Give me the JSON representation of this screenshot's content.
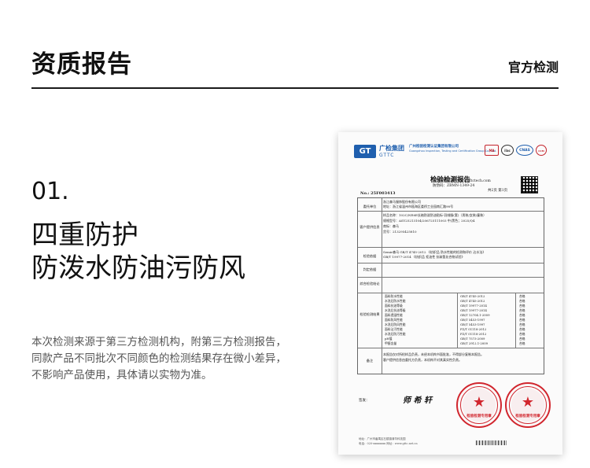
{
  "header": {
    "title": "资质报告",
    "tag": "官方检测"
  },
  "section": {
    "index": "01.",
    "heading_lines": [
      "四重防护",
      "防泼水防油污防风"
    ],
    "description_lines": [
      "本次检测来源于第三方检测机构，附第三方检测报告，",
      "同款产品不同批次不同颜色的检测结果存在微小差异，",
      "不影响产品使用，具体请以实物为准。"
    ]
  },
  "document": {
    "logo_mark": "GT",
    "logo_cn": "广检集团",
    "logo_en": "GTTC",
    "institute_cn": "广州检验检测认证集团有限公司",
    "institute_en": "Guangzhou Inspection, Testing and Certification Group Co., Ltd.",
    "certs": [
      "MA",
      "ilac",
      "CNAS",
      "CCM"
    ],
    "report_title": "检验检测报告",
    "meta_lines": [
      "报告查询网址：www.gttctech.com",
      "防伪码：ZBMN-1349-24",
      "共2页 第1页"
    ],
    "report_no": "No.: 25F003413",
    "table": {
      "labels": {
        "client": "委托单位",
        "sample": "客户提供信息",
        "test_basis": "检验依据",
        "conclusion": "判定依据",
        "overview": "综合检验结论",
        "results": "检验检测结果",
        "remarks": "备注"
      },
      "client_lines": [
        "浙江森马服饰股份有限公司",
        "地址：浙江省温州市瓯海区娄桥工业园南汇路98号"
      ],
      "sample_lines": [
        "样品名称：102C/NE6E长袖防泼防油贴标-羽绒服(套)（男装/女装/童装）",
        "规格型号：ASY25213104/206725111003 中/黑色；2025/Q4",
        "商标：森马",
        "货号：213295425810"
      ],
      "basis_lines": [
        "Semir森马 GB/T 4745-2012 《纺织品 防水性能的检测和评价 沾水法》",
        "GB/T 19977-2014 《纺织品 拒油性 抗碳氢化合物试验》"
      ],
      "items": [
        {
          "item": "面料防水性能",
          "std": "GB/T 4745-2012",
          "result": "合格"
        },
        {
          "item": "水洗后防水性能",
          "std": "GB/T 4745-2012",
          "result": "合格"
        },
        {
          "item": "面料抗油等级",
          "std": "GB/T 19977-2014",
          "result": "合格"
        },
        {
          "item": "水洗后抗油等级",
          "std": "GB/T 19977-2014",
          "result": "合格"
        },
        {
          "item": "面料透湿性能",
          "std": "GB/T 12704.1-2009",
          "result": "合格"
        },
        {
          "item": "面料防风性能",
          "std": "GB/T 5453-1997",
          "result": "合格"
        },
        {
          "item": "水洗后防风性能",
          "std": "GB/T 5453-1997",
          "result": "合格"
        },
        {
          "item": "面料沾污性能",
          "std": "FZ/T 01118-2012",
          "result": "合格"
        },
        {
          "item": "水洗后防污性能",
          "std": "FZ/T 01118-2012",
          "result": "合格"
        },
        {
          "item": "pH值",
          "std": "GB/T 7573-2009",
          "result": "合格"
        },
        {
          "item": "甲醛含量",
          "std": "GB/T 2912.1-2009",
          "result": "合格"
        }
      ],
      "remarks_lines": [
        "本报告仅对所检样品负责，未经本机构书面批准，不得部分复制本报告。",
        "客户提供信息由委托方负责，本机构不对其真实性负责。"
      ]
    },
    "sign_label": "签发：",
    "signature": "师 希 轩",
    "stamp_text_left": "检验检测专用章",
    "stamp_text_right": "检验检测专用章",
    "footer_lines": [
      "地址：广州市番禺区石楼镇清华科技园",
      "电话：020-xxxxxxxx  网址：www.gttc.net.cn"
    ]
  }
}
